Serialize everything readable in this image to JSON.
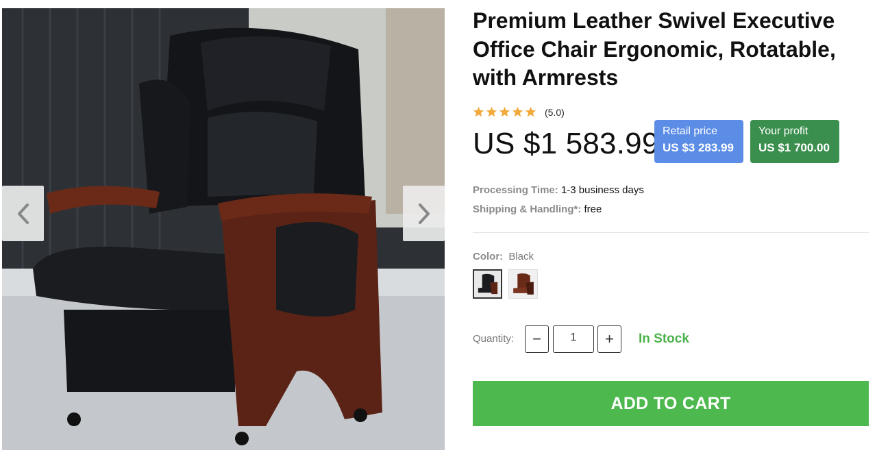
{
  "product": {
    "title": "Premium Leather Swivel Executive Office Chair Ergonomic, Rotatable, with Armrests",
    "rating_text": "(5.0)",
    "rating_value": 5,
    "rating_max": 5,
    "price": "US $1 583.99"
  },
  "badges": {
    "retail_label": "Retail price",
    "retail_value": "US $3 283.99",
    "profit_label": "Your profit",
    "profit_value": "US $1 700.00"
  },
  "shipping": {
    "processing_label": "Processing Time:",
    "processing_value": "1-3 business days",
    "shipping_label": "Shipping & Handling*:",
    "shipping_value": "free"
  },
  "color": {
    "label": "Color:",
    "selected": "Black",
    "swatches": [
      "Black",
      "Brown"
    ]
  },
  "quantity": {
    "label": "Quantity:",
    "minus": "−",
    "plus": "+",
    "value": "1"
  },
  "stock": "In Stock",
  "cart_button": "ADD TO CART",
  "gallery": {
    "prev_icon": "chevron-left-icon",
    "next_icon": "chevron-right-icon"
  },
  "colors": {
    "cart_green": "#4cb84d",
    "stock_green": "#4cb24b",
    "retail_blue": "#5b8de6",
    "profit_green": "#3b8f4e",
    "star_gold": "#f0a93a"
  }
}
